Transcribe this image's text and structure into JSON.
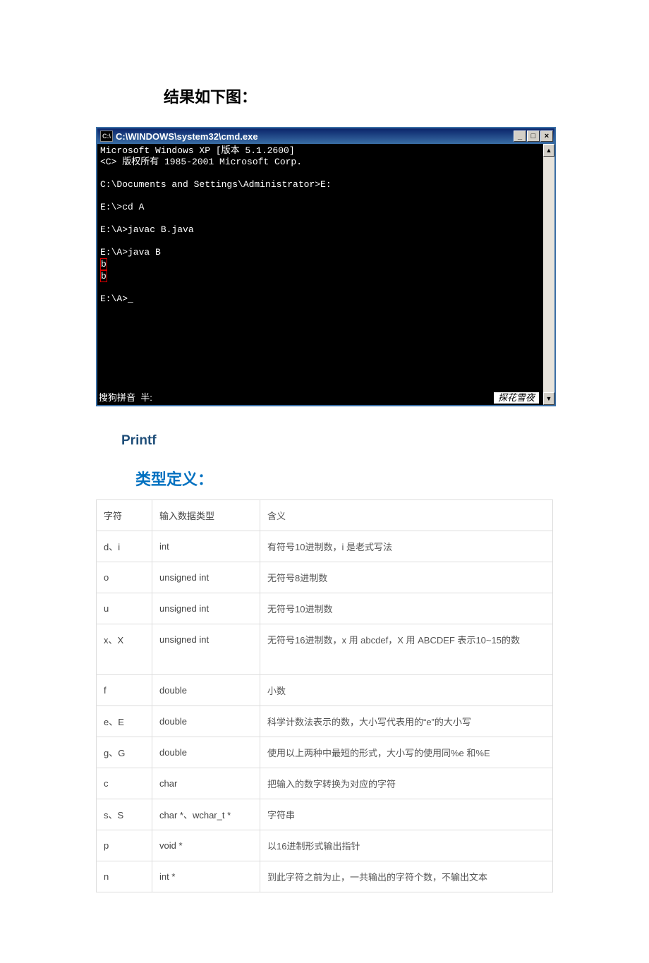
{
  "headings": {
    "result": "结果如下图：",
    "printf": "Printf",
    "typedef": "类型定义："
  },
  "cmd": {
    "icon_text": "C:\\",
    "title": "C:\\WINDOWS\\system32\\cmd.exe",
    "btn_min": "_",
    "btn_max": "□",
    "btn_close": "×",
    "scroll_up": "▲",
    "scroll_down": "▼",
    "line1": "Microsoft Windows XP [版本 5.1.2600]",
    "line2": "<C> 版权所有 1985-2001 Microsoft Corp.",
    "line4": "C:\\Documents and Settings\\Administrator>E:",
    "line6": "E:\\>cd A",
    "line8": "E:\\A>javac B.java",
    "line10": "E:\\A>java B",
    "out1": "b",
    "out2": "b",
    "prompt": "E:\\A>_",
    "ime_left": "搜狗拼音  半:",
    "ime_right": "探花雪夜"
  },
  "table": {
    "h1": "字符",
    "h2": "输入数据类型",
    "h3": "含义",
    "rows": [
      {
        "c1": "d、i",
        "c2": "int",
        "c3": "有符号10进制数，i 是老式写法"
      },
      {
        "c1": "o",
        "c2": "unsigned int",
        "c3": "无符号8进制数"
      },
      {
        "c1": "u",
        "c2": "unsigned int",
        "c3": "无符号10进制数"
      },
      {
        "c1": "x、X",
        "c2": "unsigned int",
        "c3": "无符号16进制数，x 用 abcdef，X 用 ABCDEF 表示10~15的数",
        "tall": true
      },
      {
        "c1": "f",
        "c2": "double",
        "c3": "小数"
      },
      {
        "c1": "e、E",
        "c2": "double",
        "c3": "科学计数法表示的数，大小写代表用的“e”的大小写"
      },
      {
        "c1": "g、G",
        "c2": "double",
        "c3": "使用以上两种中最短的形式，大小写的使用同%e 和%E"
      },
      {
        "c1": "c",
        "c2": "char",
        "c3": "把输入的数字转换为对应的字符"
      },
      {
        "c1": "s、S",
        "c2": "char *、wchar_t *",
        "c3": "字符串"
      },
      {
        "c1": "p",
        "c2": "void *",
        "c3": "以16进制形式输出指针"
      },
      {
        "c1": "n",
        "c2": "int *",
        "c3": "到此字符之前为止，一共输出的字符个数，不输出文本"
      }
    ]
  }
}
